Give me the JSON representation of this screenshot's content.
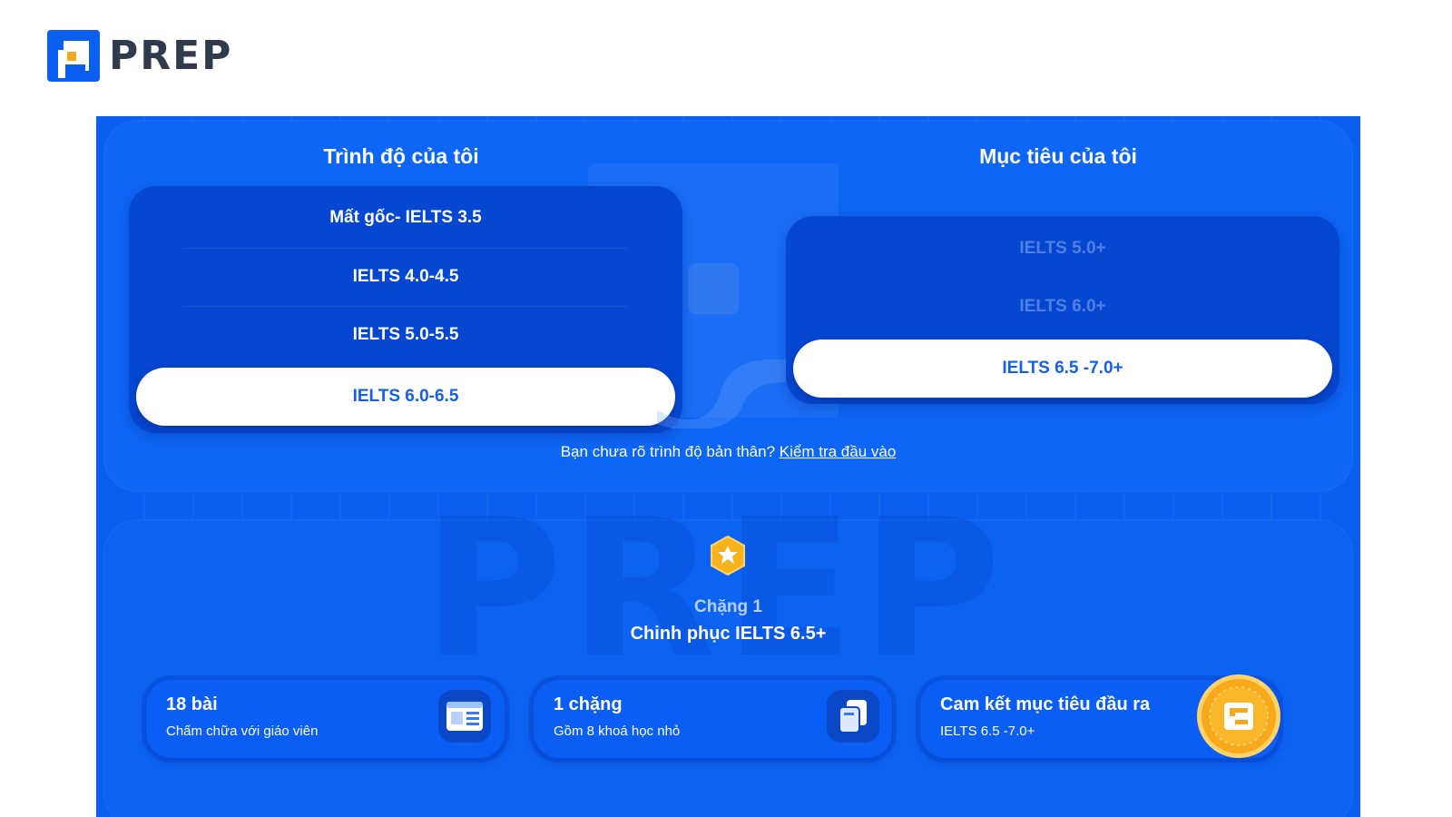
{
  "brand": {
    "name": "PREP",
    "accent": "#0a5ff0",
    "logo_orange": "#f7a81b"
  },
  "level_column": {
    "title": "Trình độ của tôi",
    "options": [
      "Mất gốc- IELTS 3.5",
      "IELTS 4.0-4.5",
      "IELTS 5.0-5.5",
      "IELTS 6.0-6.5"
    ],
    "selected": "IELTS 6.0-6.5"
  },
  "target_column": {
    "title": "Mục tiêu của tôi",
    "options": [
      "IELTS 5.0+",
      "IELTS 6.0+",
      "IELTS 6.5 -7.0+"
    ],
    "selected": "IELTS 6.5 -7.0+"
  },
  "hint": {
    "text": "Bạn chưa rõ trình độ bản thân? ",
    "link": "Kiểm tra đầu vào"
  },
  "stage": {
    "label": "Chặng 1",
    "title": "Chinh phục IELTS 6.5+",
    "badge_icon": "star-hexagon-icon"
  },
  "watermark": "PREP",
  "features": [
    {
      "title": "18 bài",
      "subtitle": "Chấm chữa với giáo viên",
      "icon": "document-icon"
    },
    {
      "title": "1 chặng",
      "subtitle": "Gồm 8 khoá học nhỏ",
      "icon": "books-icon"
    },
    {
      "title": "Cam kết mục tiêu đầu ra",
      "subtitle": "IELTS 6.5 -7.0+",
      "icon": "guarantee-seal-icon"
    }
  ]
}
